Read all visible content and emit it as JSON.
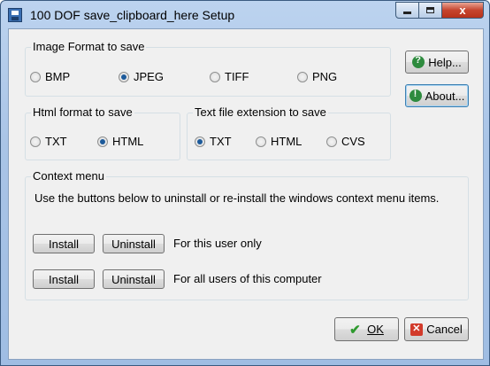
{
  "window": {
    "title": "100 DOF save_clipboard_here Setup",
    "close_glyph": "x"
  },
  "image_format": {
    "title": "Image Format to save",
    "options": [
      "BMP",
      "JPEG",
      "TIFF",
      "PNG"
    ],
    "selected": "JPEG"
  },
  "html_format": {
    "title": "Html format to save",
    "options": [
      "TXT",
      "HTML"
    ],
    "selected": "HTML"
  },
  "text_ext": {
    "title": "Text file extension to save",
    "options": [
      "TXT",
      "HTML",
      "CVS"
    ],
    "selected": "TXT"
  },
  "context_menu": {
    "title": "Context menu",
    "description": "Use the buttons below to uninstall or re-install the windows context menu items.",
    "install_label": "Install",
    "uninstall_label": "Uninstall",
    "this_user_label": "For this user only",
    "all_users_label": "For all users of this computer"
  },
  "buttons": {
    "help": "Help...",
    "about": "About...",
    "ok": "OK",
    "cancel": "Cancel"
  }
}
